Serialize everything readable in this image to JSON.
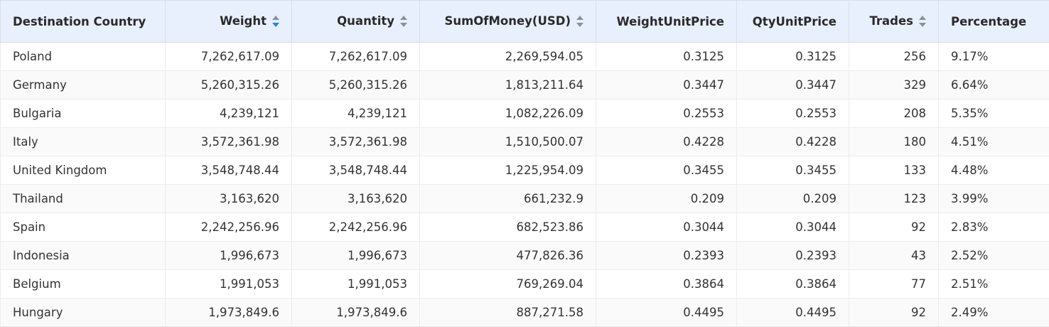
{
  "table": {
    "headers": [
      {
        "label": "Destination Country",
        "sortable": false,
        "align": "left"
      },
      {
        "label": "Weight",
        "sortable": true,
        "sort_state": "desc",
        "align": "right"
      },
      {
        "label": "Quantity",
        "sortable": true,
        "sort_state": "none",
        "align": "right"
      },
      {
        "label": "SumOfMoney(USD)",
        "sortable": true,
        "sort_state": "none",
        "align": "right"
      },
      {
        "label": "WeightUnitPrice",
        "sortable": false,
        "align": "right"
      },
      {
        "label": "QtyUnitPrice",
        "sortable": false,
        "align": "right"
      },
      {
        "label": "Trades",
        "sortable": true,
        "sort_state": "none",
        "align": "right"
      },
      {
        "label": "Percentage",
        "sortable": false,
        "align": "left"
      }
    ],
    "rows": [
      [
        "Poland",
        "7,262,617.09",
        "7,262,617.09",
        "2,269,594.05",
        "0.3125",
        "0.3125",
        "256",
        "9.17%"
      ],
      [
        "Germany",
        "5,260,315.26",
        "5,260,315.26",
        "1,813,211.64",
        "0.3447",
        "0.3447",
        "329",
        "6.64%"
      ],
      [
        "Bulgaria",
        "4,239,121",
        "4,239,121",
        "1,082,226.09",
        "0.2553",
        "0.2553",
        "208",
        "5.35%"
      ],
      [
        "Italy",
        "3,572,361.98",
        "3,572,361.98",
        "1,510,500.07",
        "0.4228",
        "0.4228",
        "180",
        "4.51%"
      ],
      [
        "United Kingdom",
        "3,548,748.44",
        "3,548,748.44",
        "1,225,954.09",
        "0.3455",
        "0.3455",
        "133",
        "4.48%"
      ],
      [
        "Thailand",
        "3,163,620",
        "3,163,620",
        "661,232.9",
        "0.209",
        "0.209",
        "123",
        "3.99%"
      ],
      [
        "Spain",
        "2,242,256.96",
        "2,242,256.96",
        "682,523.86",
        "0.3044",
        "0.3044",
        "92",
        "2.83%"
      ],
      [
        "Indonesia",
        "1,996,673",
        "1,996,673",
        "477,826.36",
        "0.2393",
        "0.2393",
        "43",
        "2.52%"
      ],
      [
        "Belgium",
        "1,991,053",
        "1,991,053",
        "769,269.04",
        "0.3864",
        "0.3864",
        "77",
        "2.51%"
      ],
      [
        "Hungary",
        "1,973,849.6",
        "1,973,849.6",
        "887,271.58",
        "0.4495",
        "0.4495",
        "92",
        "2.49%"
      ]
    ]
  },
  "colors": {
    "header_bg": "#e8f0fe",
    "sort_active": "#1e88e5",
    "sort_inactive": "#8a8f99",
    "row_alt": "#fafafa"
  }
}
